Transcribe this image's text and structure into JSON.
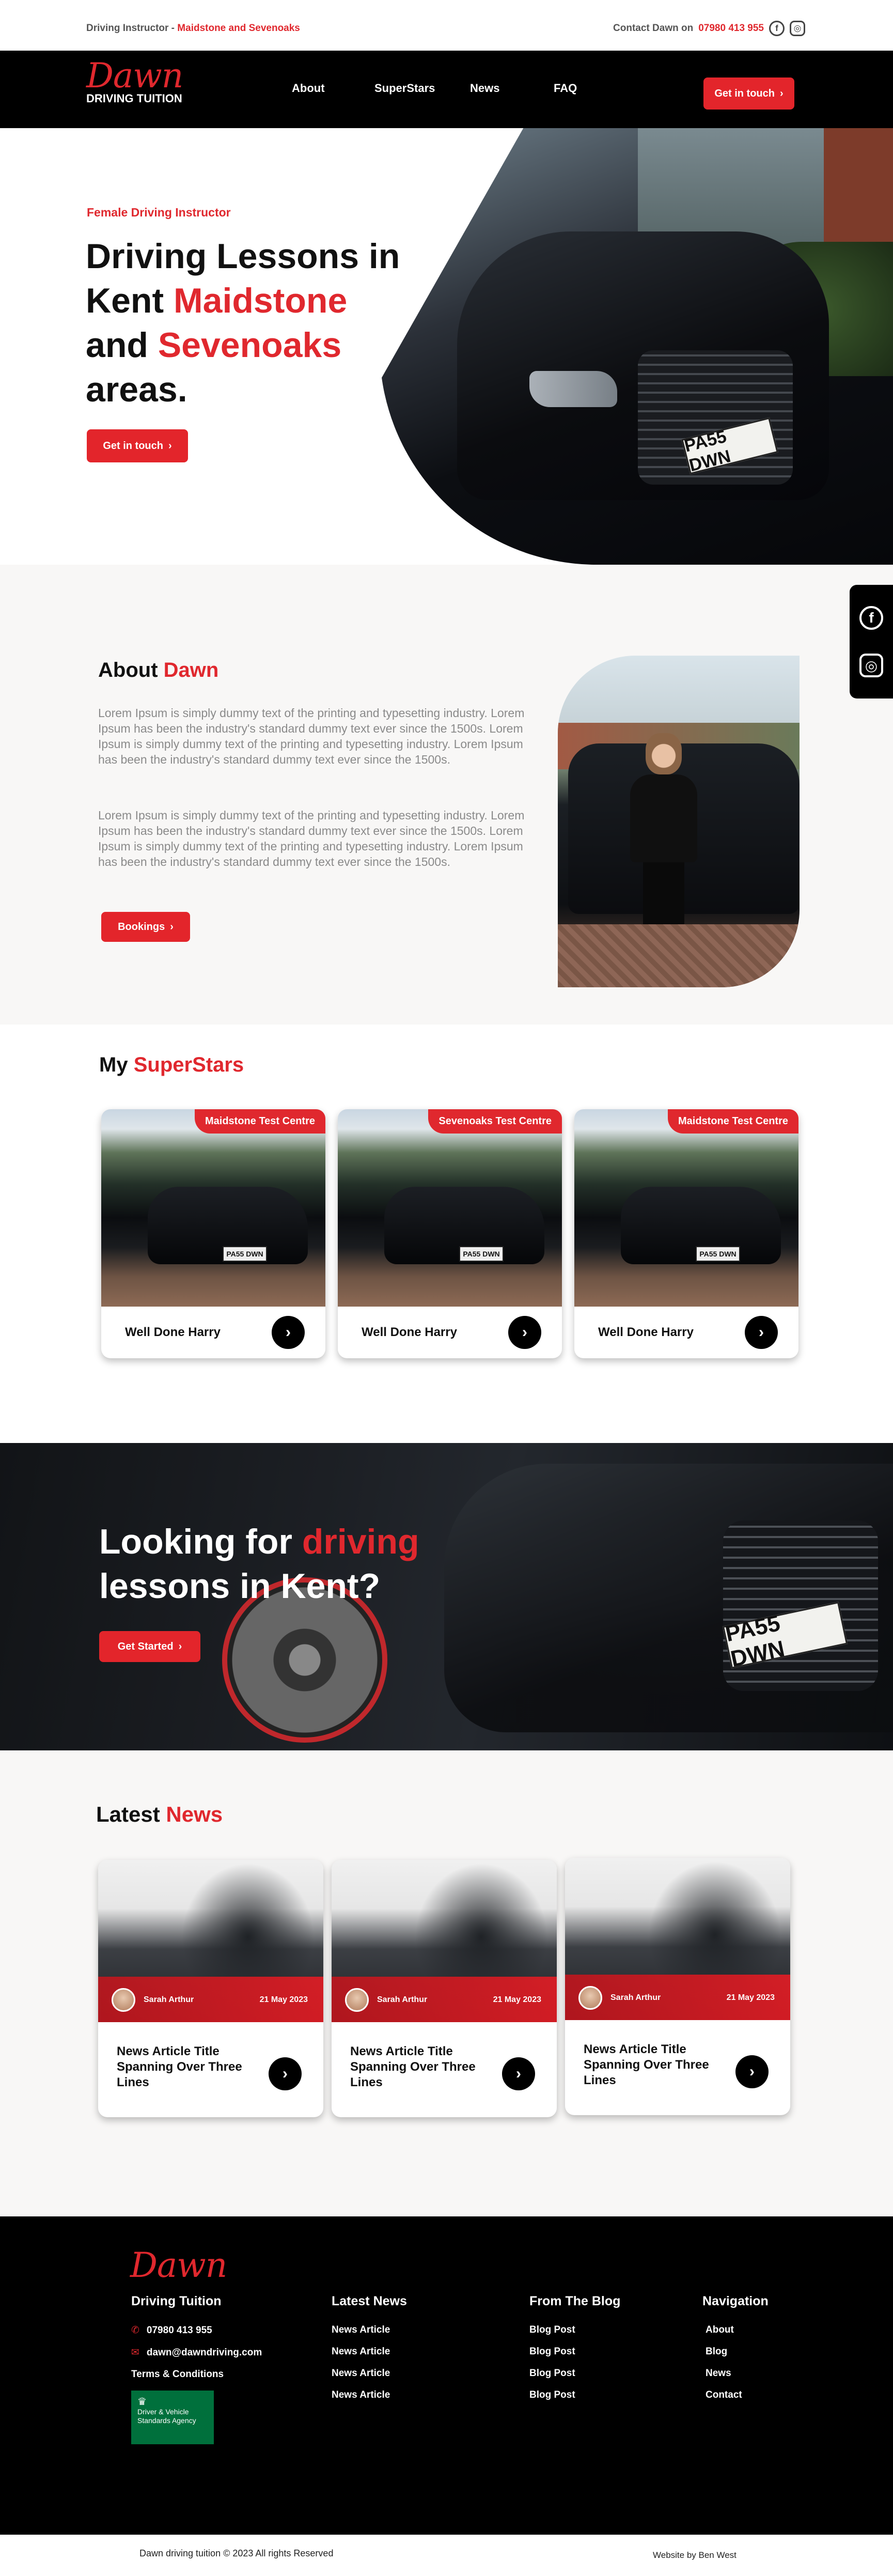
{
  "topbar": {
    "left_prefix": "Driving Instructor -",
    "left_location": "Maidstone and Sevenoaks",
    "contact_prefix": "Contact Dawn on",
    "phone": "07980 413 955",
    "facebook_glyph": "f",
    "instagram_glyph": "◎"
  },
  "nav": {
    "logo_script": "Dawn",
    "logo_sub": "DRIVING TUITION",
    "links": [
      "About",
      "SuperStars",
      "News",
      "FAQ"
    ],
    "cta": "Get in touch",
    "cta_arrow": "›"
  },
  "hero": {
    "subtitle": "Female Driving Instructor",
    "line1": "Driving Lessons in",
    "line2_a": "Kent",
    "line2_b": "Maidstone",
    "line3_a": "and",
    "line3_b": "Sevenoaks",
    "line4": "areas.",
    "cta": "Get in touch",
    "cta_arrow": "›",
    "plate": "PA55 DWN"
  },
  "side_social": {
    "facebook_glyph": "f",
    "instagram_glyph": "◎"
  },
  "about": {
    "title_a": "About",
    "title_b": "Dawn",
    "para1": "Lorem Ipsum is simply dummy text of the printing and typesetting industry. Lorem Ipsum has been the industry's standard dummy text ever since the 1500s. Lorem Ipsum is simply dummy text of the printing and typesetting industry. Lorem Ipsum has been the industry's standard dummy text ever since the 1500s.",
    "para2": "Lorem Ipsum is simply dummy text of the printing and typesetting industry. Lorem Ipsum has been the industry's standard dummy text ever since the 1500s. Lorem Ipsum is simply dummy text of the printing and typesetting industry. Lorem Ipsum has been the industry's standard dummy text ever since the 1500s.",
    "cta": "Bookings",
    "cta_arrow": "›"
  },
  "superstars": {
    "title_a": "My",
    "title_b": "SuperStars",
    "cards": [
      {
        "tag": "Maidstone Test Centre",
        "name": "Well Done Harry",
        "plate": "PA55 DWN"
      },
      {
        "tag": "Sevenoaks Test Centre",
        "name": "Well Done Harry",
        "plate": "PA55 DWN"
      },
      {
        "tag": "Maidstone Test Centre",
        "name": "Well Done Harry",
        "plate": "PA55 DWN"
      }
    ],
    "arrow": "›"
  },
  "cta_banner": {
    "line1_a": "Looking for",
    "line1_b": "driving",
    "line2": "lessons in Kent?",
    "cta": "Get Started",
    "cta_arrow": "›",
    "plate": "PA55 DWN"
  },
  "news": {
    "title_a": "Latest",
    "title_b": "News",
    "cards": [
      {
        "author": "Sarah Arthur",
        "date": "21 May 2023",
        "title": "News Article Title Spanning Over Three Lines"
      },
      {
        "author": "Sarah Arthur",
        "date": "21 May 2023",
        "title": "News Article Title Spanning Over Three Lines"
      },
      {
        "author": "Sarah Arthur",
        "date": "21 May 2023",
        "title": "News Article Title Spanning Over Three Lines"
      }
    ],
    "arrow": "›"
  },
  "footer": {
    "logo_script": "Dawn",
    "col1": {
      "title": "Driving Tuition",
      "phone": "07980 413 955",
      "email": "dawn@dawndriving.com",
      "terms": "Terms & Conditions",
      "badge": "Driver & Vehicle Standards Agency"
    },
    "col2": {
      "title": "Latest News",
      "items": [
        "News Article",
        "News Article",
        "News Article",
        "News Article"
      ]
    },
    "col3": {
      "title": "From The Blog",
      "items": [
        "Blog Post",
        "Blog Post",
        "Blog Post",
        "Blog Post"
      ]
    },
    "col4": {
      "title": "Navigation",
      "items": [
        "About",
        "Blog",
        "News",
        "Contact"
      ]
    }
  },
  "bottom": {
    "copyright": "Dawn driving tuition  © 2023 All rights Reserved",
    "credit": "Website by Ben West"
  },
  "colors": {
    "accent": "#e0282e",
    "dark": "#000000",
    "section_bg": "#f8f7f6",
    "dvsa": "#00703c"
  }
}
